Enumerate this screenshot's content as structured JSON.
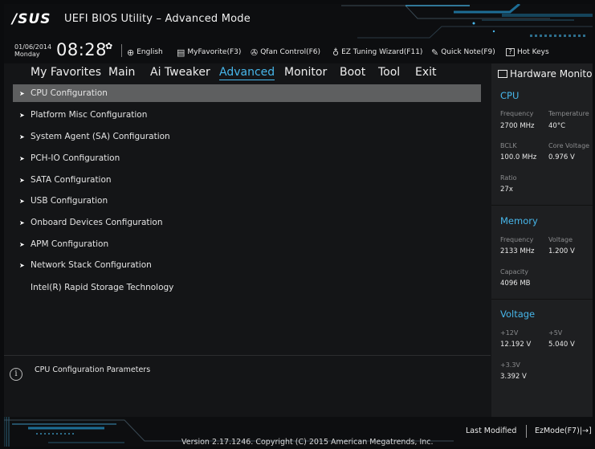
{
  "header": {
    "logo": "/SUS",
    "title": "UEFI BIOS Utility – Advanced Mode",
    "date": "01/06/2014",
    "weekday": "Monday",
    "time": "08:28",
    "settings_icon": "gear-icon"
  },
  "toolbar": [
    {
      "label": "English",
      "icon": "globe-icon"
    },
    {
      "label": "MyFavorite(F3)",
      "icon": "favorite-icon"
    },
    {
      "label": "Qfan Control(F6)",
      "icon": "fan-icon"
    },
    {
      "label": "EZ Tuning Wizard(F11)",
      "icon": "bulb-icon"
    },
    {
      "label": "Quick Note(F9)",
      "icon": "note-icon"
    },
    {
      "label": "Hot Keys",
      "icon": "hotkeys-icon",
      "key": "?"
    }
  ],
  "tabs": [
    {
      "label": "My Favorites",
      "active": false
    },
    {
      "label": "Main",
      "active": false
    },
    {
      "label": "Ai Tweaker",
      "active": false
    },
    {
      "label": "Advanced",
      "active": true
    },
    {
      "label": "Monitor",
      "active": false
    },
    {
      "label": "Boot",
      "active": false
    },
    {
      "label": "Tool",
      "active": false
    },
    {
      "label": "Exit",
      "active": false
    }
  ],
  "menu_items": [
    {
      "label": "CPU Configuration",
      "submenu": true,
      "selected": true
    },
    {
      "label": "Platform Misc Configuration",
      "submenu": true,
      "selected": false
    },
    {
      "label": "System Agent (SA) Configuration",
      "submenu": true,
      "selected": false
    },
    {
      "label": "PCH-IO Configuration",
      "submenu": true,
      "selected": false
    },
    {
      "label": "SATA Configuration",
      "submenu": true,
      "selected": false
    },
    {
      "label": "USB Configuration",
      "submenu": true,
      "selected": false
    },
    {
      "label": "Onboard Devices Configuration",
      "submenu": true,
      "selected": false
    },
    {
      "label": "APM Configuration",
      "submenu": true,
      "selected": false
    },
    {
      "label": "Network Stack Configuration",
      "submenu": true,
      "selected": false
    },
    {
      "label": "Intel(R) Rapid Storage Technology",
      "submenu": false,
      "selected": false
    }
  ],
  "help": {
    "icon": "info-icon",
    "text": "CPU Configuration Parameters"
  },
  "hardware_monitor": {
    "title": "Hardware Monitor",
    "cpu": {
      "heading": "CPU",
      "frequency_label": "Frequency",
      "frequency": "2700 MHz",
      "temperature_label": "Temperature",
      "temperature": "40°C",
      "bclk_label": "BCLK",
      "bclk": "100.0 MHz",
      "core_voltage_label": "Core Voltage",
      "core_voltage": "0.976 V",
      "ratio_label": "Ratio",
      "ratio": "27x"
    },
    "memory": {
      "heading": "Memory",
      "frequency_label": "Frequency",
      "frequency": "2133 MHz",
      "voltage_label": "Voltage",
      "voltage": "1.200 V",
      "capacity_label": "Capacity",
      "capacity": "4096 MB"
    },
    "voltage": {
      "heading": "Voltage",
      "v12_label": "+12V",
      "v12": "12.192 V",
      "v5_label": "+5V",
      "v5": "5.040 V",
      "v33_label": "+3.3V",
      "v33": "3.392 V"
    }
  },
  "footer": {
    "version": "Version 2.17.1246. Copyright (C) 2015 American Megatrends, Inc.",
    "last_modified": "Last Modified",
    "ezmode": "EzMode(F7)|→]"
  },
  "colors": {
    "accent": "#47b6ea",
    "selected_row": "#5e5f60",
    "background": "#141517",
    "panel": "#1e1f21"
  }
}
